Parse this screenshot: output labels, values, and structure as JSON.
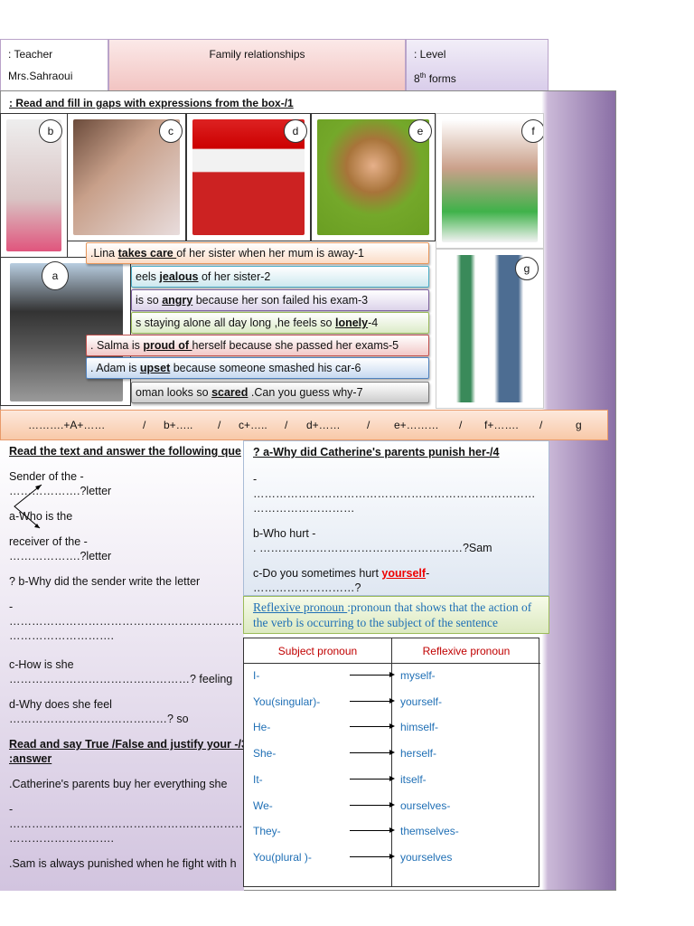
{
  "header": {
    "teacher_label": ": Teacher",
    "teacher_name": "Mrs.Sahraoui",
    "title": "Family relationships",
    "level_label": ": Level",
    "level_value": "8",
    "level_sup": "th",
    "level_suffix": " forms"
  },
  "exercise1": {
    "instruction": ": Read and fill in gaps with expressions from the box-/1",
    "photo_labels": [
      "a",
      "b",
      "c",
      "d",
      "e",
      "f",
      "g"
    ],
    "sentences": [
      {
        "pre": ".Lina ",
        "key": "takes care ",
        "post": "of her sister when her mum is away-1"
      },
      {
        "pre": "eels ",
        "key": "jealous",
        "post": " of her sister-2"
      },
      {
        "pre": " is so ",
        "key": "angry",
        "post": "  because her son failed his exam-3"
      },
      {
        "pre": "s staying alone all day long ,he  feels so ",
        "key": " lonely",
        "post": "-4"
      },
      {
        "pre": ". Salma is ",
        "key": "proud of ",
        "post": "herself because she passed her exams-5"
      },
      {
        "pre": " . Adam is ",
        "key": "upset",
        "post": " because someone smashed his car-6"
      },
      {
        "pre": "oman looks so ",
        "key": "scared",
        "post": " .Can you guess why-7"
      }
    ],
    "answers": [
      "……….+A+……",
      "/",
      "b+…..",
      "/",
      "c+…..",
      "/",
      "d+……",
      "/",
      "e+………",
      "/",
      "f+…….",
      "/",
      "g"
    ]
  },
  "reading": {
    "heading": " Read the text and answer the following que",
    "q_a1": "Sender of the  -",
    "q_a1b": "……………….?letter",
    "q_a2": " a-Who is the",
    "q_a3": "receiver of the -",
    "q_a3b": "……………….?letter",
    "q_b": "? b-Why did the sender write the letter",
    "dash": "-",
    "dots_long": "……………………………………………………………",
    "dots_short": " ……………………….",
    "q_c": "c-How is she",
    "q_c_ans": "…………………………………………? feeling",
    "q_d": "d-Why  does she feel",
    "q_d_ans": " ……………………………………? so",
    "tf_heading": "Read and say True /False and justify your -/3",
    "tf_heading2": ":answer",
    "tf1": ".Catherine's parents  buy her everything  she",
    "tf2": ".Sam is always punished when he fight with h"
  },
  "right": {
    "q_a": "? a-Why did Catherine's parents punish her-/4",
    "dash": "-",
    "dots_long": "…………………………………………………………………",
    "dots_short": "………………………",
    "q_b": "b-Who hurt -",
    "q_b_ans": ". ………………………………………………?Sam",
    "q_c": "c-Do you sometimes hurt ",
    "q_c_key": "yourself",
    "q_c_end": "-",
    "q_c_ans": " ………………………?"
  },
  "definition": {
    "term": "Reflexive pronoun ",
    "text": ":pronoun that shows that the action of the verb is occurring to the subject of the sentence"
  },
  "table": {
    "headers": [
      "Subject pronoun",
      "Reflexive pronoun"
    ],
    "rows": [
      [
        "I-",
        "myself-"
      ],
      [
        "You(singular)-",
        "yourself-"
      ],
      [
        "He-",
        "himself-"
      ],
      [
        "She-",
        "herself-"
      ],
      [
        "It-",
        "itself-"
      ],
      [
        "We-",
        "ourselves-"
      ],
      [
        "They-",
        "themselves-"
      ],
      [
        "You(plural )-",
        "yourselves"
      ]
    ]
  }
}
